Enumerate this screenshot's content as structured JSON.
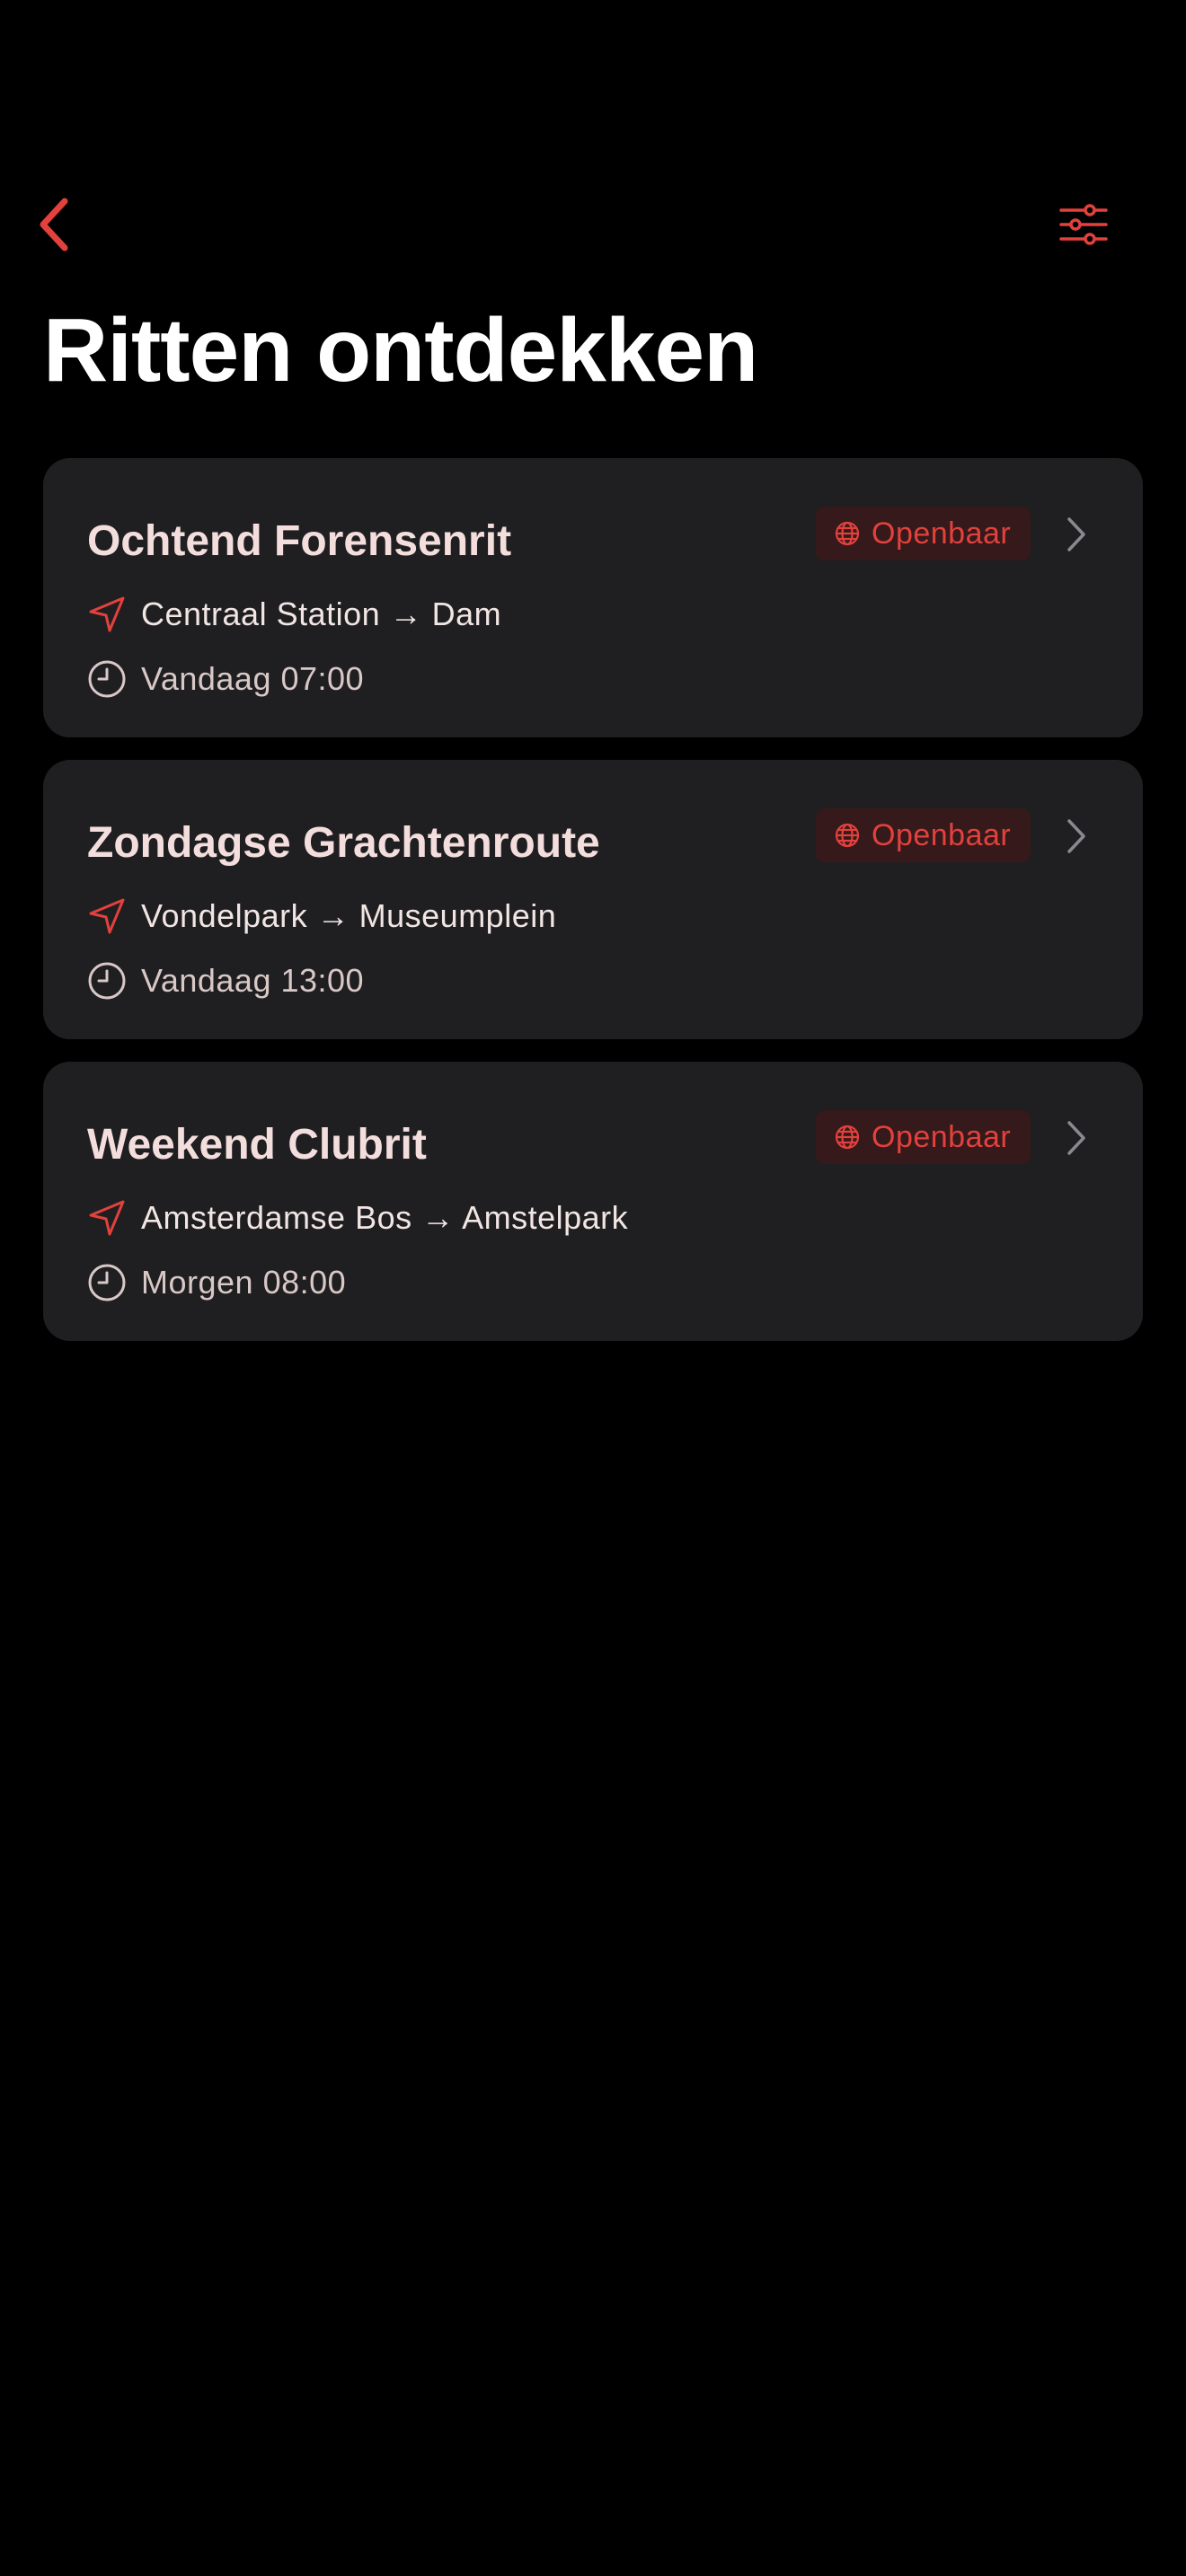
{
  "header": {
    "back_icon": "chevron-left-icon",
    "filter_icon": "sliders-icon",
    "title": "Ritten ontdekken"
  },
  "colors": {
    "background": "#000000",
    "card": "#1f1f21",
    "accent": "#e2413c",
    "badge_background": "#35191b",
    "title_text": "#f4dedd"
  },
  "rides": [
    {
      "title": "Ochtend Forensenrit",
      "visibility": "Openbaar",
      "visibility_icon": "globe-icon",
      "route": "Centraal Station → Dam",
      "route_icon": "navigation-arrow-icon",
      "time": "Vandaag 07:00",
      "time_icon": "clock-icon"
    },
    {
      "title": "Zondagse Grachtenroute",
      "visibility": "Openbaar",
      "visibility_icon": "globe-icon",
      "route": "Vondelpark → Museumplein",
      "route_icon": "navigation-arrow-icon",
      "time": "Vandaag 13:00",
      "time_icon": "clock-icon"
    },
    {
      "title": "Weekend Clubrit",
      "visibility": "Openbaar",
      "visibility_icon": "globe-icon",
      "route": "Amsterdamse Bos → Amstelpark",
      "route_icon": "navigation-arrow-icon",
      "time": "Morgen 08:00",
      "time_icon": "clock-icon"
    }
  ]
}
